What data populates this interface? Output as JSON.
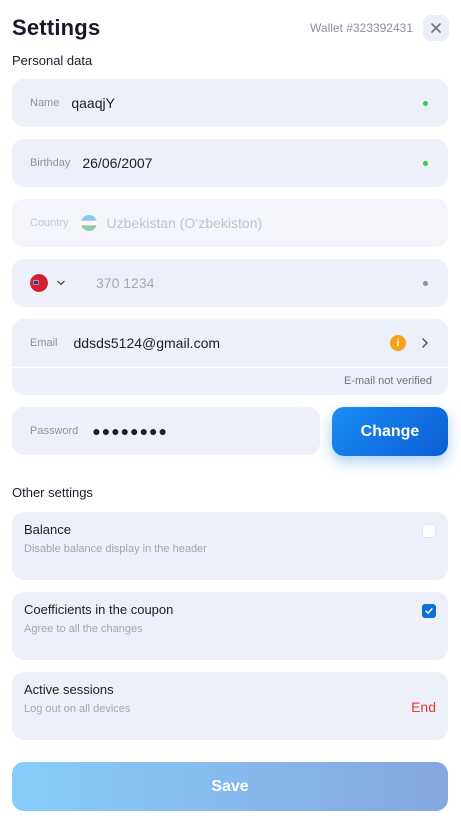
{
  "header": {
    "title": "Settings",
    "wallet": "Wallet #323392431"
  },
  "personal": {
    "section_label": "Personal data",
    "name": {
      "label": "Name",
      "value": "qaaqjY",
      "status_color": "#2bd04b"
    },
    "birthday": {
      "label": "Birthday",
      "value": "26/06/2007",
      "status_color": "#2bd04b"
    },
    "country": {
      "label": "Country",
      "value": "Uzbekistan (O‘zbekiston)"
    },
    "phone": {
      "placeholder": "370 1234"
    },
    "email": {
      "label": "Email",
      "value": "ddsds5124@gmail.com",
      "note": "E-mail not verified",
      "warn_glyph": "i"
    },
    "password": {
      "label": "Password",
      "value": "●●●●●●●●"
    },
    "change_button": "Change"
  },
  "other": {
    "section_label": "Other settings",
    "cards": [
      {
        "title": "Balance",
        "subtitle": "Disable balance display in the header",
        "checked": false
      },
      {
        "title": "Coefficients in the coupon",
        "subtitle": "Agree to all the changes",
        "checked": true
      },
      {
        "title": "Active sessions",
        "subtitle": "Log out on all devices",
        "action": "End"
      }
    ]
  },
  "save_button": "Save",
  "colors": {
    "accent": "#0f6fd6",
    "danger": "#e53935",
    "warning": "#f7a21b",
    "field_bg": "#edf0f8"
  },
  "icons": [
    "close-icon",
    "uzbekistan-flag-icon",
    "phone-country-flag-icon",
    "chevron-down-icon",
    "warning-icon",
    "chevron-right-icon",
    "check-icon"
  ]
}
